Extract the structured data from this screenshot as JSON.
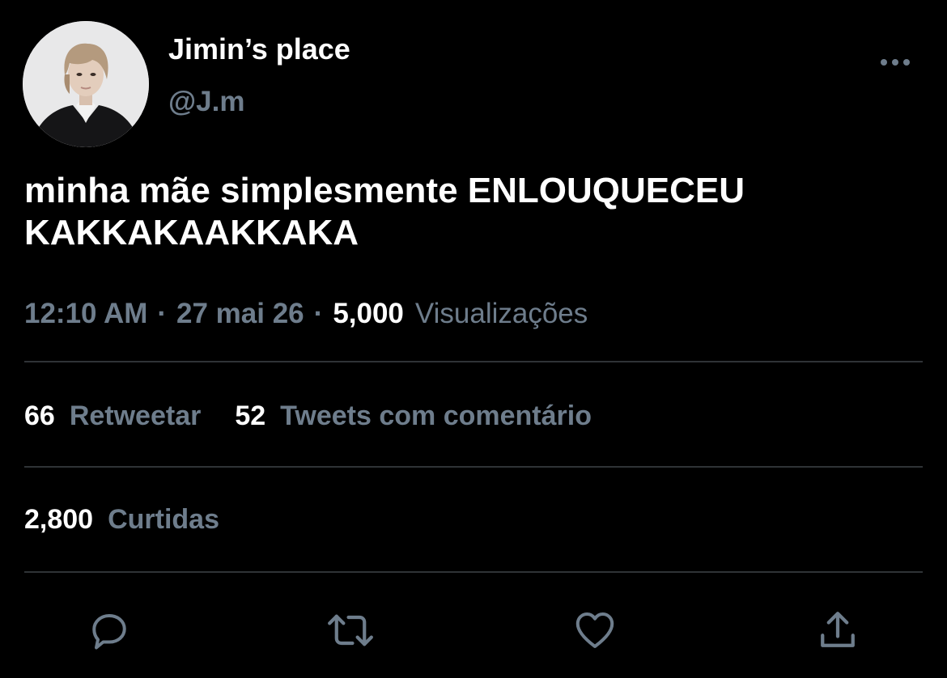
{
  "author": {
    "display_name": "Jimin’s place",
    "handle": "@J.m",
    "avatar_icon": "profile-photo"
  },
  "tweet": {
    "text_line1": "minha mãe simplesmente ENLOUQUECEU",
    "text_line2": "KAKKAKAAKKAKA"
  },
  "meta": {
    "time": "12:10 AM",
    "separator": "·",
    "date": "27 mai 26",
    "views_count": "5,000",
    "views_label": "Visualizações"
  },
  "stats": {
    "retweets_count": "66",
    "retweets_label": "Retweetar",
    "quotes_count": "52",
    "quotes_label": "Tweets com comentário",
    "likes_count": "2,800",
    "likes_label": "Curtidas"
  },
  "actions": [
    {
      "icon": "reply-icon"
    },
    {
      "icon": "retweet-icon"
    },
    {
      "icon": "like-icon"
    },
    {
      "icon": "share-icon"
    }
  ],
  "colors": {
    "background": "#000000",
    "primary_text": "#ffffff",
    "secondary_text": "#6e7d8c",
    "divider": "#2f3336"
  }
}
